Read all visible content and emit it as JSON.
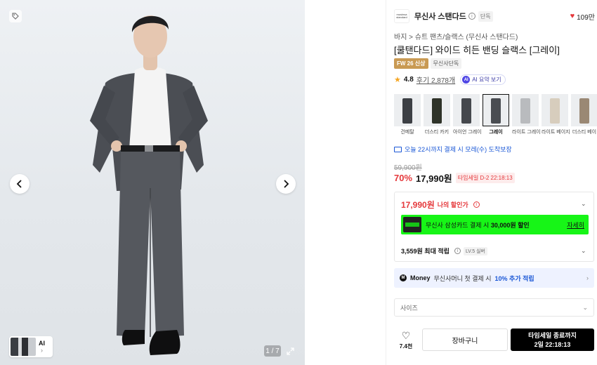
{
  "gallery": {
    "counter": "1 / 7",
    "thumb_ai_label": "AI"
  },
  "brand": {
    "logo_text": "musinsa standard",
    "name": "무신사 스탠다드",
    "info": "i",
    "exclusive": "단독",
    "likes": "109만"
  },
  "breadcrumb": "바지 > 슈트 팬츠/슬랙스 (무신사 스탠다드)",
  "title": "[쿨탠다드] 와이드 히든 밴딩 슬랙스 [그레이]",
  "badges": {
    "season": "FW 26 신상",
    "exclusive": "무신사단독"
  },
  "rating": {
    "score": "4.8",
    "reviews": "후기 2,878개",
    "ai_summary": "AI 요약 보기",
    "ai_dot": "AI"
  },
  "colors": [
    {
      "label": "건메탈",
      "color": "#3c3f44",
      "selected": false
    },
    {
      "label": "더스티 카키",
      "color": "#2f3329",
      "selected": false
    },
    {
      "label": "아이언 그레이",
      "color": "#45484d",
      "selected": false
    },
    {
      "label": "그레이",
      "color": "#4a4d52",
      "selected": true
    },
    {
      "label": "라이트 그레이",
      "color": "#b9bbbe",
      "selected": false
    },
    {
      "label": "라이트 베이지",
      "color": "#d7cdbd",
      "selected": false
    },
    {
      "label": "더스티 베이",
      "color": "#9a8874",
      "selected": false
    }
  ],
  "delivery": "오늘 22시까지 결제 시 모레(수) 도착보장",
  "price": {
    "original": "59,900원",
    "discount": "70%",
    "sale": "17,990원",
    "timesale": "타임세일 D-2 22:18:13"
  },
  "benefit": {
    "my_price": "17,990원",
    "my_price_label": "나의 할인가",
    "card_text_pre": "무신사 삼성카드 결제 시",
    "card_text_bold": "30,000원 할인",
    "card_detail": "자세히",
    "points": "3,559원 최대 적립",
    "level": "LV.5 실버"
  },
  "money": {
    "logo": "M",
    "brand": "Money",
    "text": "무신사머니 첫 결제 시",
    "highlight": "10% 추가 적립"
  },
  "size_placeholder": "사이즈",
  "bottom": {
    "wish_count": "7.4천",
    "cart": "장바구니",
    "buy_line1": "타임세일 종료까지",
    "buy_line2": "2일 22:18:13"
  },
  "accent": {
    "red": "#e5383b",
    "blue": "#1a57d6",
    "green": "#17f517",
    "gold": "#c99a53"
  }
}
